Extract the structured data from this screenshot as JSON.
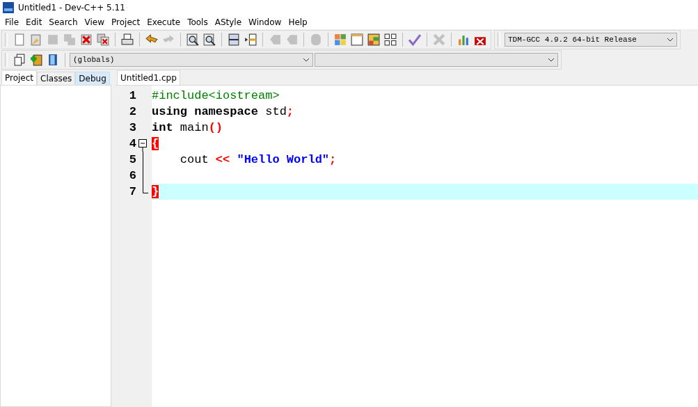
{
  "window": {
    "title": "Untitled1 - Dev-C++ 5.11"
  },
  "menu": [
    "File",
    "Edit",
    "Search",
    "View",
    "Project",
    "Execute",
    "Tools",
    "AStyle",
    "Window",
    "Help"
  ],
  "toolbar": {
    "groups": [
      [
        {
          "kind": "page",
          "disabled": false
        },
        {
          "kind": "folder",
          "disabled": false
        },
        {
          "kind": "disk",
          "disabled": true
        },
        {
          "kind": "disks",
          "disabled": true
        },
        {
          "kind": "close",
          "disabled": false
        },
        {
          "kind": "close-all",
          "disabled": false
        }
      ],
      [
        {
          "kind": "printer",
          "disabled": false
        }
      ],
      [
        {
          "kind": "undo",
          "disabled": false
        },
        {
          "kind": "redo",
          "disabled": true
        }
      ],
      [
        {
          "kind": "magnifier",
          "disabled": false
        },
        {
          "kind": "magnifier",
          "disabled": false
        }
      ],
      [
        {
          "kind": "panes",
          "disabled": false
        },
        {
          "kind": "indent",
          "disabled": false
        }
      ],
      [
        {
          "kind": "tag",
          "disabled": true
        },
        {
          "kind": "tag",
          "disabled": true
        }
      ],
      [
        {
          "kind": "stop",
          "disabled": true
        }
      ],
      [
        {
          "kind": "tiles",
          "disabled": false
        },
        {
          "kind": "window",
          "disabled": false
        },
        {
          "kind": "colors",
          "disabled": false
        },
        {
          "kind": "grid",
          "disabled": false
        }
      ],
      [
        {
          "kind": "check",
          "disabled": false
        }
      ],
      [
        {
          "kind": "cross",
          "disabled": true
        }
      ],
      [
        {
          "kind": "chart",
          "disabled": false
        },
        {
          "kind": "chart-cross",
          "disabled": false
        }
      ]
    ],
    "compiler": "TDM-GCC 4.9.2 64-bit Release"
  },
  "toolbar2": {
    "icons": [
      {
        "kind": "copy",
        "disabled": false
      },
      {
        "kind": "add",
        "disabled": false
      },
      {
        "kind": "book",
        "disabled": false
      }
    ],
    "scope": "(globals)"
  },
  "side_tabs": [
    {
      "label": "Project",
      "selected": true,
      "hovered": false
    },
    {
      "label": "Classes",
      "selected": false,
      "hovered": false
    },
    {
      "label": "Debug",
      "selected": false,
      "hovered": true
    }
  ],
  "editor_tabs": [
    {
      "label": "Untitled1.cpp",
      "selected": true
    }
  ],
  "code": [
    {
      "number": "1",
      "fold_start": false,
      "fold_end": false,
      "current": false,
      "tokens": [
        {
          "kind": "preproc",
          "text": "#include<iostream>"
        }
      ]
    },
    {
      "number": "2",
      "fold_start": false,
      "fold_end": false,
      "current": false,
      "tokens": [
        {
          "kind": "keyword",
          "text": "using namespace"
        },
        {
          "kind": "plain",
          "text": " std"
        },
        {
          "kind": "symbol",
          "text": ";"
        }
      ]
    },
    {
      "number": "3",
      "fold_start": false,
      "fold_end": false,
      "current": false,
      "tokens": [
        {
          "kind": "keyword",
          "text": "int"
        },
        {
          "kind": "plain",
          "text": " main"
        },
        {
          "kind": "symbol",
          "text": "()"
        }
      ]
    },
    {
      "number": "4",
      "fold_start": true,
      "fold_end": false,
      "current": false,
      "tokens": [
        {
          "kind": "brace",
          "text": "{"
        }
      ]
    },
    {
      "number": "5",
      "fold_start": false,
      "fold_end": false,
      "current": false,
      "tokens": [
        {
          "kind": "plain",
          "text": "    cout "
        },
        {
          "kind": "symbol",
          "text": "<< "
        },
        {
          "kind": "string",
          "text": "\"Hello World\""
        },
        {
          "kind": "symbol",
          "text": ";"
        }
      ]
    },
    {
      "number": "6",
      "fold_start": false,
      "fold_end": false,
      "current": false
    },
    {
      "number": "7",
      "fold_start": false,
      "fold_end": true,
      "current": true,
      "tokens": [
        {
          "kind": "brace",
          "text": "}"
        }
      ]
    }
  ]
}
